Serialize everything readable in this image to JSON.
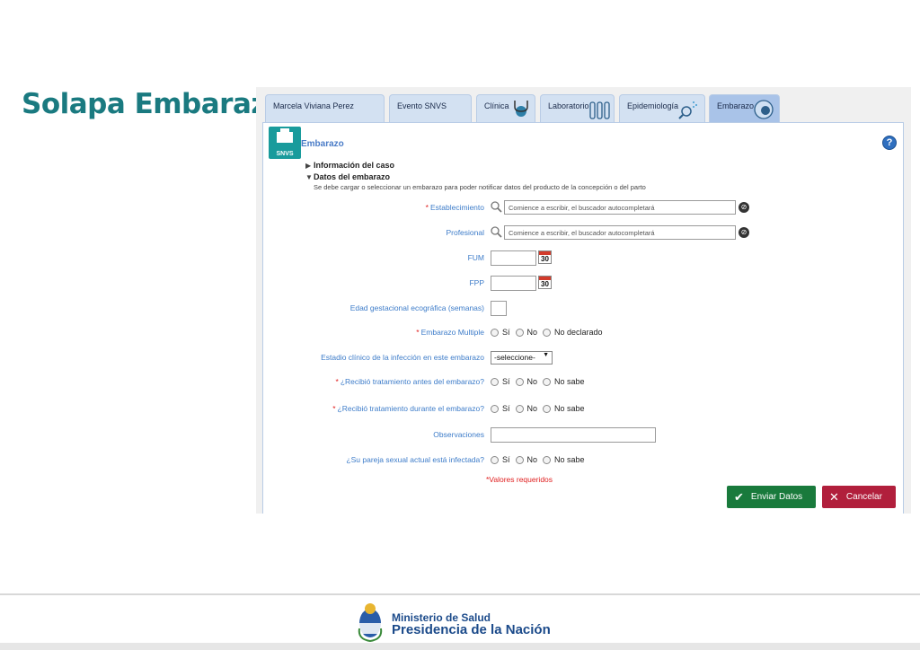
{
  "slide": {
    "title": "Solapa Embarazo"
  },
  "tabs": [
    {
      "label": "Marcela Viviana Perez"
    },
    {
      "label": "Evento SNVS"
    },
    {
      "label": "Clínica"
    },
    {
      "label": "Laboratorio"
    },
    {
      "label": "Epidemiología"
    },
    {
      "label": "Embarazo",
      "active": true
    }
  ],
  "panel": {
    "title": "Embarazo",
    "logo_text": "SNVS",
    "help": "?"
  },
  "sections": {
    "info": "Información del caso",
    "datos": "Datos del embarazo",
    "note": "Se debe cargar o seleccionar un embarazo para poder notificar datos del producto de la concepción o del parto"
  },
  "form": {
    "establecimiento": {
      "label": "Establecimiento",
      "placeholder": "Comience a escribir, el buscador autocompletará"
    },
    "profesional": {
      "label": "Profesional",
      "placeholder": "Comience a escribir, el buscador autocompletará"
    },
    "fum": {
      "label": "FUM",
      "cal": "30"
    },
    "fpp": {
      "label": "FPP",
      "cal": "30"
    },
    "edad": {
      "label": "Edad gestacional ecográfica (semanas)"
    },
    "multiple": {
      "label": "Embarazo Multiple",
      "options": [
        "Sí",
        "No",
        "No declarado"
      ]
    },
    "estadio": {
      "label": "Estadio clínico de la infección en este embarazo",
      "selected": "-seleccione-"
    },
    "antes": {
      "label": "¿Recibió tratamiento antes del embarazo?",
      "options": [
        "Sí",
        "No",
        "No sabe"
      ]
    },
    "durante": {
      "label": "¿Recibió tratamiento durante el embarazo?",
      "options": [
        "Sí",
        "No",
        "No sabe"
      ]
    },
    "observaciones": {
      "label": "Observaciones"
    },
    "pareja": {
      "label": "¿Su pareja sexual actual está infectada?",
      "options": [
        "Sí",
        "No",
        "No sabe"
      ]
    },
    "required_note": "*Valores requeridos",
    "required_mark": "*"
  },
  "buttons": {
    "send": "Enviar Datos",
    "cancel": "Cancelar"
  },
  "footer": {
    "ministry": "Ministerio de Salud",
    "presidencia": "Presidencia de la Nación"
  },
  "colors": {
    "title": "#1a7a80",
    "label": "#3d7cc9",
    "send": "#197a3c",
    "cancel": "#b11f3c"
  }
}
